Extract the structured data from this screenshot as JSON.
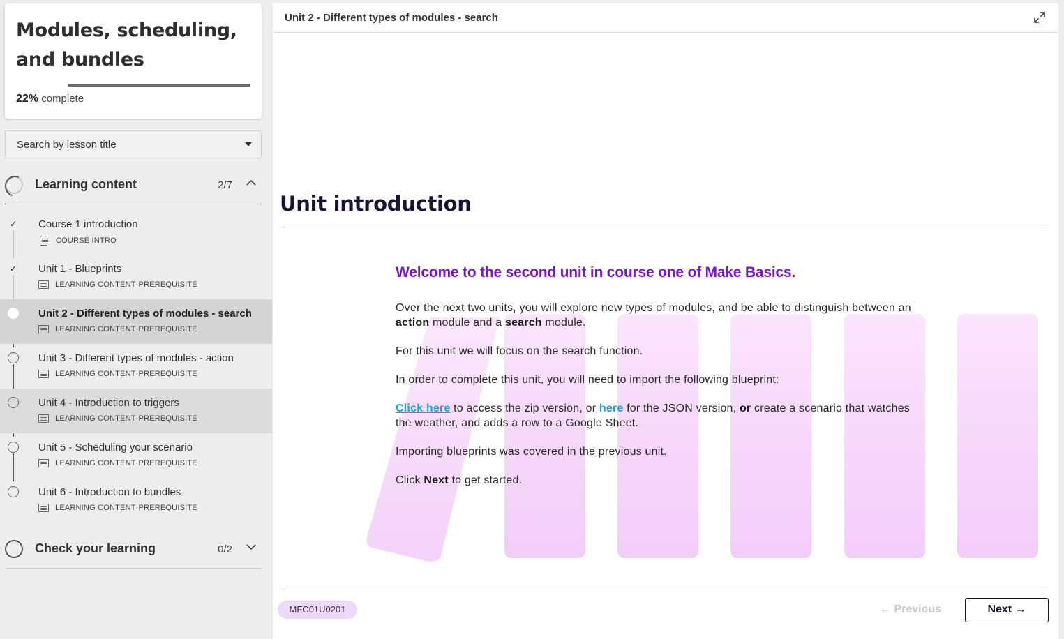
{
  "sidebar": {
    "course_title": "Modules, scheduling, and bundles",
    "progress_percent": "22%",
    "progress_value": 22,
    "progress_label": "complete",
    "search_placeholder": "Search by lesson title",
    "sections": [
      {
        "title": "Learning content",
        "count": "2/7",
        "expanded": true
      },
      {
        "title": "Check your learning",
        "count": "0/2",
        "expanded": false
      }
    ],
    "lessons": [
      {
        "title": "Course 1 introduction",
        "type": "COURSE INTRO",
        "tag": "",
        "status": "complete"
      },
      {
        "title": "Unit 1 - Blueprints",
        "type": "LEARNING CONTENT",
        "tag": "PREREQUISITE",
        "status": "complete"
      },
      {
        "title": "Unit 2 - Different types of modules - search",
        "type": "LEARNING CONTENT",
        "tag": "PREREQUISITE",
        "status": "current"
      },
      {
        "title": "Unit 3 - Different types of modules - action",
        "type": "LEARNING CONTENT",
        "tag": "PREREQUISITE",
        "status": "not-started"
      },
      {
        "title": "Unit 4 - Introduction to triggers",
        "type": "LEARNING CONTENT",
        "tag": "PREREQUISITE",
        "status": "not-started"
      },
      {
        "title": "Unit 5 - Scheduling your scenario",
        "type": "LEARNING CONTENT",
        "tag": "PREREQUISITE",
        "status": "not-started"
      },
      {
        "title": "Unit 6 - Introduction to bundles",
        "type": "LEARNING CONTENT",
        "tag": "PREREQUISITE",
        "status": "not-started"
      }
    ],
    "meta_separator": " · "
  },
  "main": {
    "header_title": "Unit 2 - Different types of modules - search",
    "unit_heading": "Unit introduction",
    "welcome_heading": "Welcome to the second unit in course one of Make Basics.",
    "p1_a": "Over the next two units, you will explore new types of modules, and be able to distinguish between an ",
    "p1_b": "action",
    "p1_c": " module and a ",
    "p1_d": "search",
    "p1_e": " module.",
    "p2": "For this unit we will focus on the search function.",
    "p3": "In order to complete this unit, you will need to import the following blueprint:",
    "p4_link1": "Click here",
    "p4_a": " to access the zip version, or ",
    "p4_link2": "here",
    "p4_b": " for the JSON version, ",
    "p4_c": "or",
    "p4_d": " create a scenario that watches the weather, and adds a row to a Google Sheet.",
    "p5": "Importing blueprints was covered in the previous unit.",
    "p6_a": "Click ",
    "p6_b": "Next",
    "p6_c": " to get started.",
    "code": "MFC01U0201",
    "prev_label": "← Previous",
    "next_label": "Next →"
  },
  "colors": {
    "accent_purple": "#7a16c8",
    "link_blue": "#13a6d6",
    "navy": "#1c1330",
    "deco_pink": "#f6d3fb"
  }
}
